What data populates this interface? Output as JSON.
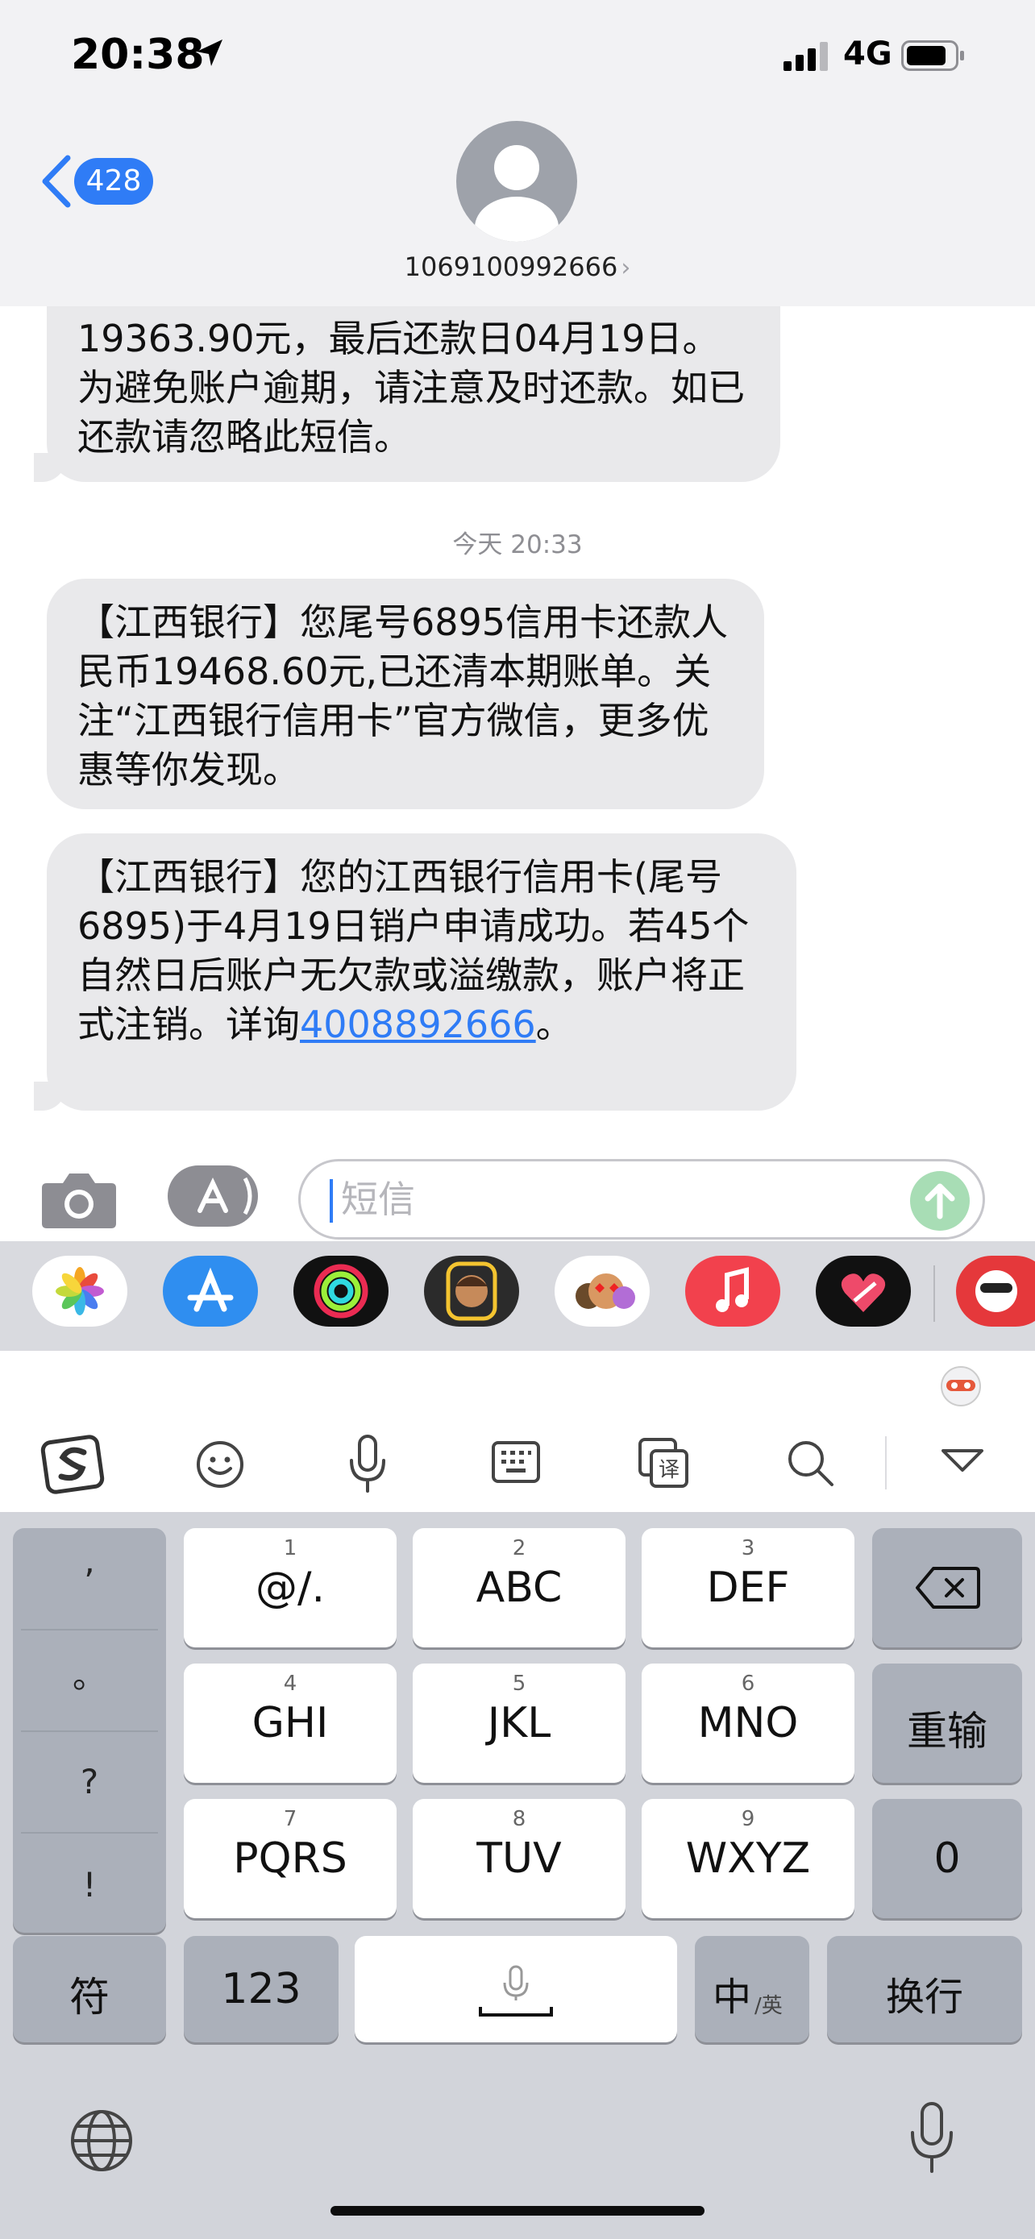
{
  "status_bar": {
    "time": "20:38",
    "network": "4G"
  },
  "header": {
    "back_count": "428",
    "contact": "1069100992666"
  },
  "messages": [
    {
      "text": "19363.90元，最后还款日04月19日。为避免账户逾期，请注意及时还款。如已还款请忽略此短信。",
      "partial": true
    },
    {
      "text": "【江西银行】您尾号6895信用卡还款人民币19468.60元,已还清本期账单。关注“江西银行信用卡”官方微信，更多优惠等你发现。"
    },
    {
      "text_pre": "【江西银行】您的江西银行信用卡(尾号6895)于4月19日销户申请成功。若45个自然日后账户无欠款或溢缴款，账户将正式注销。详询",
      "link": "4008892666",
      "text_post": "。"
    }
  ],
  "timestamp": "今天 20:33",
  "input": {
    "placeholder": "短信"
  },
  "app_drawer": [
    "photos-app",
    "app-store-app",
    "activity-app",
    "memoji-app",
    "memoji-stickers-app",
    "music-app",
    "heart-app",
    "sogou-mascot-app"
  ],
  "toolbar_icons": [
    "sogou-logo-icon",
    "emoji-icon",
    "microphone-icon",
    "keyboard-layout-icon",
    "translate-icon",
    "search-icon",
    "collapse-icon"
  ],
  "keyboard": {
    "punctuation": [
      ",",
      "。",
      "?",
      "!"
    ],
    "keys": [
      {
        "num": "1",
        "label": "@/."
      },
      {
        "num": "2",
        "label": "ABC"
      },
      {
        "num": "3",
        "label": "DEF"
      },
      {
        "num": "4",
        "label": "GHI"
      },
      {
        "num": "5",
        "label": "JKL"
      },
      {
        "num": "6",
        "label": "MNO"
      },
      {
        "num": "7",
        "label": "PQRS"
      },
      {
        "num": "8",
        "label": "TUV"
      },
      {
        "num": "9",
        "label": "WXYZ"
      }
    ],
    "reenter": "重输",
    "zero": "0",
    "symbols": "符",
    "numbers": "123",
    "lang_main": "中",
    "lang_sub": "/英",
    "return": "换行"
  },
  "colors": {
    "accent": "#2f7cf6",
    "bubble": "#e9e9eb",
    "keyboard_bg": "#d2d4da",
    "send_disabled": "#a8ddb5"
  }
}
